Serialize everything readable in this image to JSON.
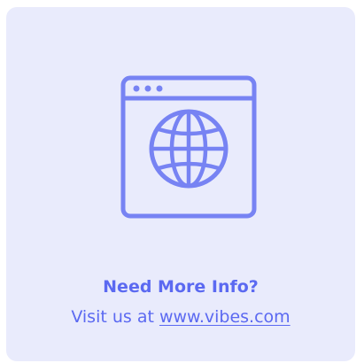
{
  "card": {
    "icon": "browser-globe-icon",
    "headline": "Need More Info?",
    "visit_prefix": "Visit us at ",
    "link_text": "www.vibes.com"
  },
  "colors": {
    "card_background": "#e9ebfc",
    "accent": "#5b69f1",
    "icon_stroke": "#7783f3"
  }
}
